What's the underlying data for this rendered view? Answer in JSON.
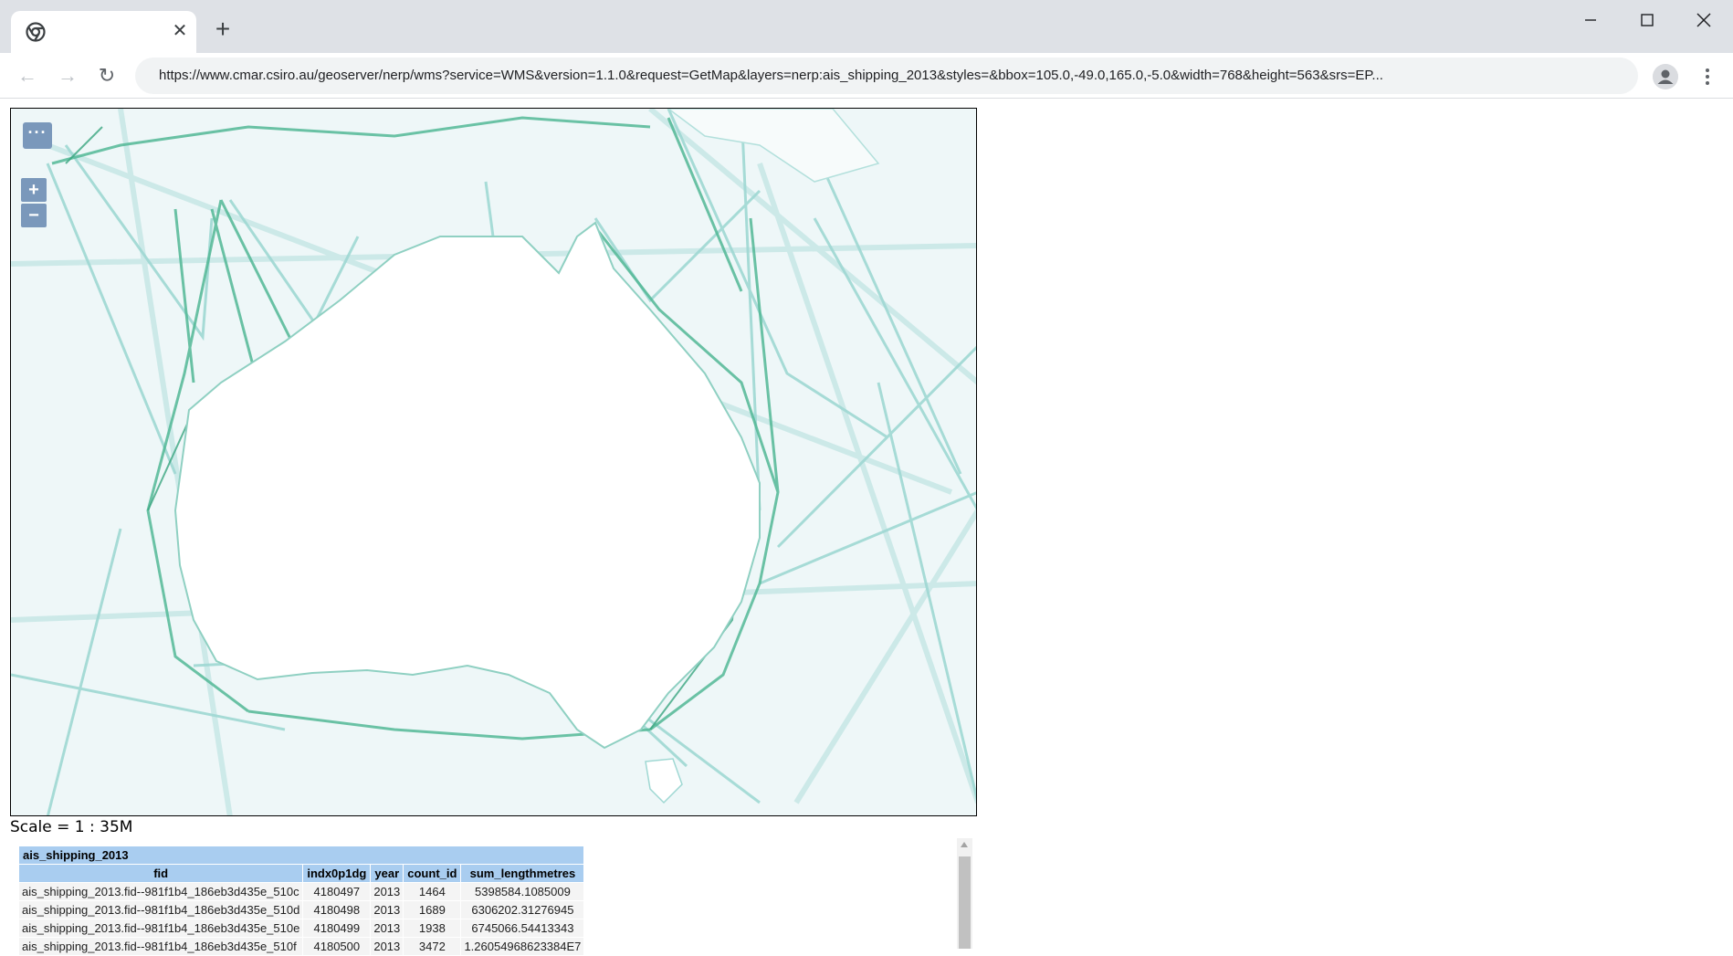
{
  "browser": {
    "tab_title": "",
    "url": "https://www.cmar.csiro.au/geoserver/nerp/wms?service=WMS&version=1.1.0&request=GetMap&layers=nerp:ais_shipping_2013&styles=&bbox=105.0,-49.0,165.0,-5.0&width=768&height=563&srs=EP..."
  },
  "map": {
    "zoom_in_label": "+",
    "zoom_out_label": "−",
    "layer_switch_label": "···",
    "scale_text": "Scale = 1 : 35M",
    "colors": {
      "ocean": "#eef7f8",
      "route_light": "#9fd8d3",
      "route_dark": "#3aa57f",
      "land": "#ffffff"
    }
  },
  "feature_table": {
    "title": "ais_shipping_2013",
    "columns": [
      "fid",
      "indx0p1dg",
      "year",
      "count_id",
      "sum_lengthmetres"
    ],
    "rows": [
      [
        "ais_shipping_2013.fid--981f1b4_186eb3d435e_510c",
        "4180497",
        "2013",
        "1464",
        "5398584.1085009"
      ],
      [
        "ais_shipping_2013.fid--981f1b4_186eb3d435e_510d",
        "4180498",
        "2013",
        "1689",
        "6306202.31276945"
      ],
      [
        "ais_shipping_2013.fid--981f1b4_186eb3d435e_510e",
        "4180499",
        "2013",
        "1938",
        "6745066.54413343"
      ],
      [
        "ais_shipping_2013.fid--981f1b4_186eb3d435e_510f",
        "4180500",
        "2013",
        "3472",
        "1.26054968623384E7"
      ]
    ]
  }
}
